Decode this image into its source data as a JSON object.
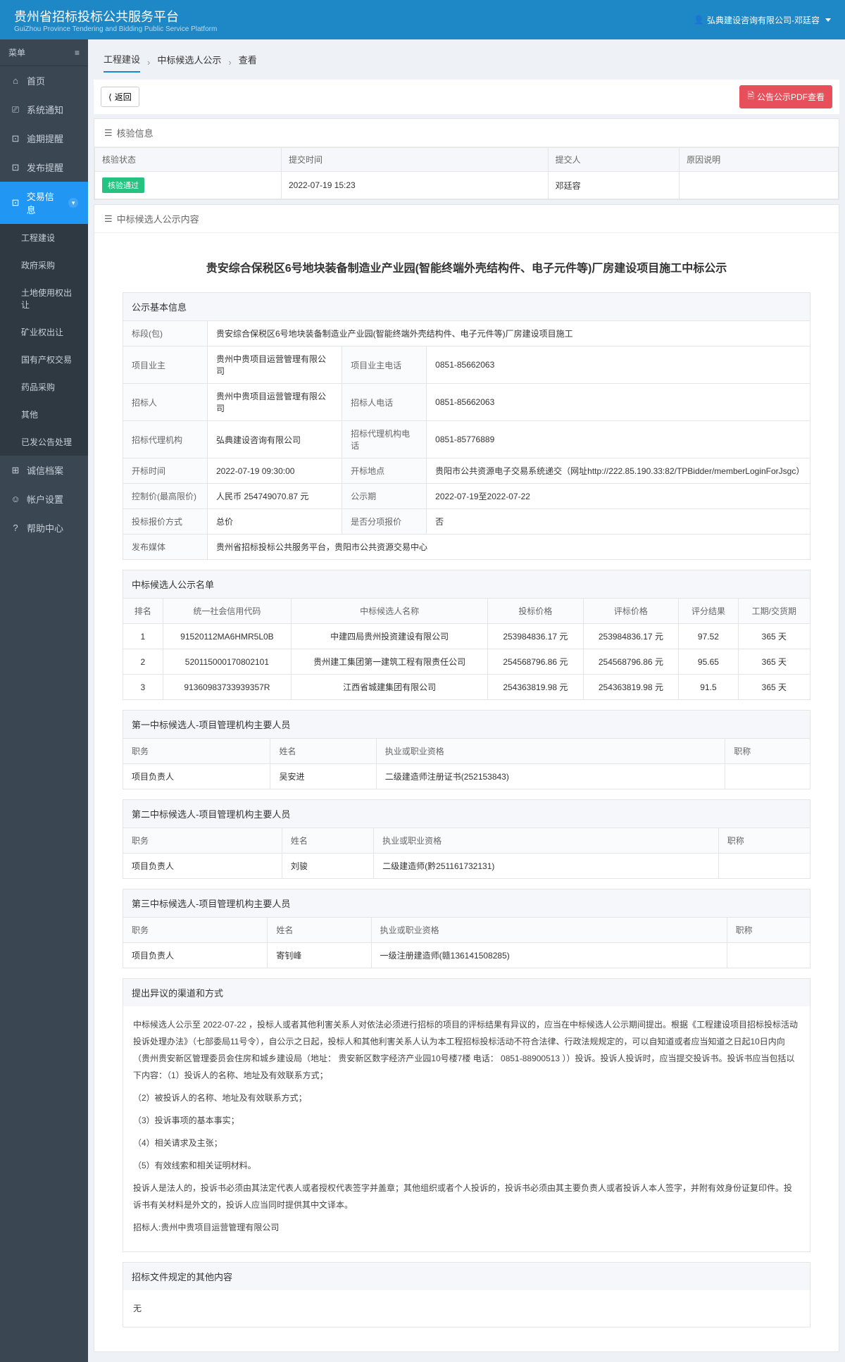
{
  "header": {
    "title": "贵州省招标投标公共服务平台",
    "subtitle": "GuiZhou Province Tendering and Bidding Public Service Platform",
    "user": "弘典建设咨询有限公司-邓廷容"
  },
  "sidebar": {
    "menu_label": "菜单",
    "items": [
      {
        "icon": "⌂",
        "label": "首页"
      },
      {
        "icon": "⎚",
        "label": "系统通知"
      },
      {
        "icon": "⊡",
        "label": "逾期提醒"
      },
      {
        "icon": "⊡",
        "label": "发布提醒"
      },
      {
        "icon": "⊡",
        "label": "交易信息",
        "active": true
      },
      {
        "icon": "⊞",
        "label": "诚信档案"
      },
      {
        "icon": "☺",
        "label": "帐户设置"
      },
      {
        "icon": "?",
        "label": "帮助中心"
      }
    ],
    "sub_items": [
      "工程建设",
      "政府采购",
      "土地使用权出让",
      "矿业权出让",
      "国有产权交易",
      "药品采购",
      "其他",
      "已发公告处理"
    ]
  },
  "breadcrumb": [
    "工程建设",
    "中标候选人公示",
    "查看"
  ],
  "toolbar": {
    "back": "返回",
    "pdf": "公告公示PDF查看"
  },
  "verify": {
    "title": "核验信息",
    "headers": [
      "核验状态",
      "提交时间",
      "提交人",
      "原因说明"
    ],
    "row": {
      "status": "核验通过",
      "time": "2022-07-19 15:23",
      "user": "邓廷容",
      "reason": ""
    }
  },
  "announce": {
    "panel_title": "中标候选人公示内容",
    "doc_title": "贵安综合保税区6号地块装备制造业产业园(智能终端外壳结构件、电子元件等)厂房建设项目施工中标公示",
    "basic_title": "公示基本信息",
    "basic": {
      "bid_pkg_label": "标段(包)",
      "bid_pkg": "贵安综合保税区6号地块装备制造业产业园(智能终端外壳结构件、电子元件等)厂房建设项目施工",
      "owner_label": "项目业主",
      "owner": "贵州中贵项目运营管理有限公司",
      "owner_tel_label": "项目业主电话",
      "owner_tel": "0851-85662063",
      "tenderer_label": "招标人",
      "tenderer": "贵州中贵项目运营管理有限公司",
      "tenderer_tel_label": "招标人电话",
      "tenderer_tel": "0851-85662063",
      "agency_label": "招标代理机构",
      "agency": "弘典建设咨询有限公司",
      "agency_tel_label": "招标代理机构电话",
      "agency_tel": "0851-85776889",
      "open_time_label": "开标时间",
      "open_time": "2022-07-19 09:30:00",
      "open_place_label": "开标地点",
      "open_place": "贵阳市公共资源电子交易系统递交（网址http://222.85.190.33:82/TPBidder/memberLoginForJsgc）",
      "ceiling_label": "控制价(最高限价)",
      "ceiling": "人民币 254749070.87 元",
      "period_label": "公示期",
      "period": "2022-07-19至2022-07-22",
      "quote_mode_label": "投标报价方式",
      "quote_mode": "总价",
      "split_label": "是否分项报价",
      "split": "否",
      "media_label": "发布媒体",
      "media": "贵州省招标投标公共服务平台，贵阳市公共资源交易中心"
    },
    "list_title": "中标候选人公示名单",
    "list_headers": [
      "排名",
      "统一社会信用代码",
      "中标候选人名称",
      "投标价格",
      "评标价格",
      "评分结果",
      "工期/交货期"
    ],
    "list_rows": [
      {
        "rank": "1",
        "code": "91520112MA6HMR5L0B",
        "name": "中建四局贵州投资建设有限公司",
        "bid": "253984836.17 元",
        "eval": "253984836.17 元",
        "score": "97.52",
        "period": "365 天"
      },
      {
        "rank": "2",
        "code": "520115000170802101",
        "name": "贵州建工集团第一建筑工程有限责任公司",
        "bid": "254568796.86 元",
        "eval": "254568796.86 元",
        "score": "95.65",
        "period": "365 天"
      },
      {
        "rank": "3",
        "code": "91360983733939357R",
        "name": "江西省城建集团有限公司",
        "bid": "254363819.98 元",
        "eval": "254363819.98 元",
        "score": "91.5",
        "period": "365 天"
      }
    ],
    "candidates": [
      {
        "title": "第一中标候选人-项目管理机构主要人员",
        "role": "项目负责人",
        "name": "吴安进",
        "cert": "二级建造师注册证书(252153843)",
        "job": ""
      },
      {
        "title": "第二中标候选人-项目管理机构主要人员",
        "role": "项目负责人",
        "name": "刘骏",
        "cert": "二级建造师(黔251161732131)",
        "job": ""
      },
      {
        "title": "第三中标候选人-项目管理机构主要人员",
        "role": "项目负责人",
        "name": "寄钊峰",
        "cert": "一级注册建造师(赣136141508285)",
        "job": ""
      }
    ],
    "cand_headers": [
      "职务",
      "姓名",
      "执业或职业资格",
      "职称"
    ],
    "objection_title": "提出异议的渠道和方式",
    "objection_paras": [
      "中标候选人公示至 2022-07-22 ，投标人或者其他利害关系人对依法必须进行招标的项目的评标结果有异议的，应当在中标候选人公示期间提出。根据《工程建设项目招标投标活动投诉处理办法》（七部委局11号令），自公示之日起，投标人和其他利害关系人认为本工程招标投标活动不符合法律、行政法规规定的，可以自知道或者应当知道之日起10日内向（贵州贵安新区管理委员会住房和城乡建设局（地址： 贵安新区数字经济产业园10号楼7楼 电话： 0851-88900513 ））投诉。投诉人投诉时，应当提交投诉书。投诉书应当包括以下内容：（1）投诉人的名称、地址及有效联系方式；",
      "（2）被投诉人的名称、地址及有效联系方式；",
      "（3）投诉事项的基本事实；",
      "（4）相关请求及主张；",
      "（5）有效线索和相关证明材料。",
      "投诉人是法人的，投诉书必须由其法定代表人或者授权代表签字并盖章；其他组织或者个人投诉的，投诉书必须由其主要负责人或者投诉人本人签字，并附有效身份证复印件。投诉书有关材料是外文的，投诉人应当同时提供其中文译本。",
      "招标人:贵州中贵项目运营管理有限公司"
    ],
    "other_title": "招标文件规定的其他内容",
    "other_text": "无"
  }
}
